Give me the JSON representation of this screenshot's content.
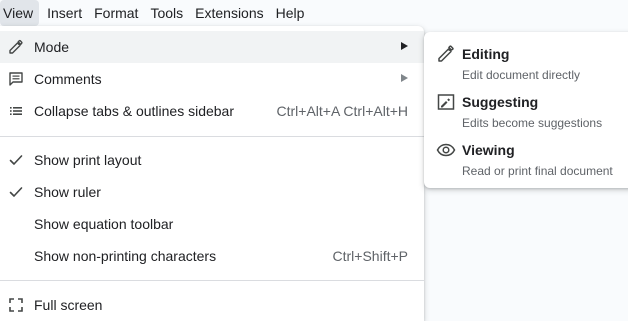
{
  "menubar": {
    "items": [
      "View",
      "Insert",
      "Format",
      "Tools",
      "Extensions",
      "Help"
    ]
  },
  "view_menu": {
    "mode": {
      "label": "Mode"
    },
    "comments": {
      "label": "Comments"
    },
    "collapse_sidebar": {
      "label": "Collapse tabs & outlines sidebar",
      "shortcut": "Ctrl+Alt+A Ctrl+Alt+H"
    },
    "print_layout": {
      "label": "Show print layout",
      "checked": true
    },
    "ruler": {
      "label": "Show ruler",
      "checked": true
    },
    "equation_toolbar": {
      "label": "Show equation toolbar",
      "checked": false
    },
    "non_printing": {
      "label": "Show non-printing characters",
      "shortcut": "Ctrl+Shift+P",
      "checked": false
    },
    "full_screen": {
      "label": "Full screen"
    }
  },
  "mode_submenu": {
    "items": [
      {
        "icon": "pencil-icon",
        "title": "Editing",
        "desc": "Edit document directly"
      },
      {
        "icon": "suggest-edit-icon",
        "title": "Suggesting",
        "desc": "Edits become suggestions"
      },
      {
        "icon": "eye-icon",
        "title": "Viewing",
        "desc": "Read or print final document"
      }
    ]
  }
}
